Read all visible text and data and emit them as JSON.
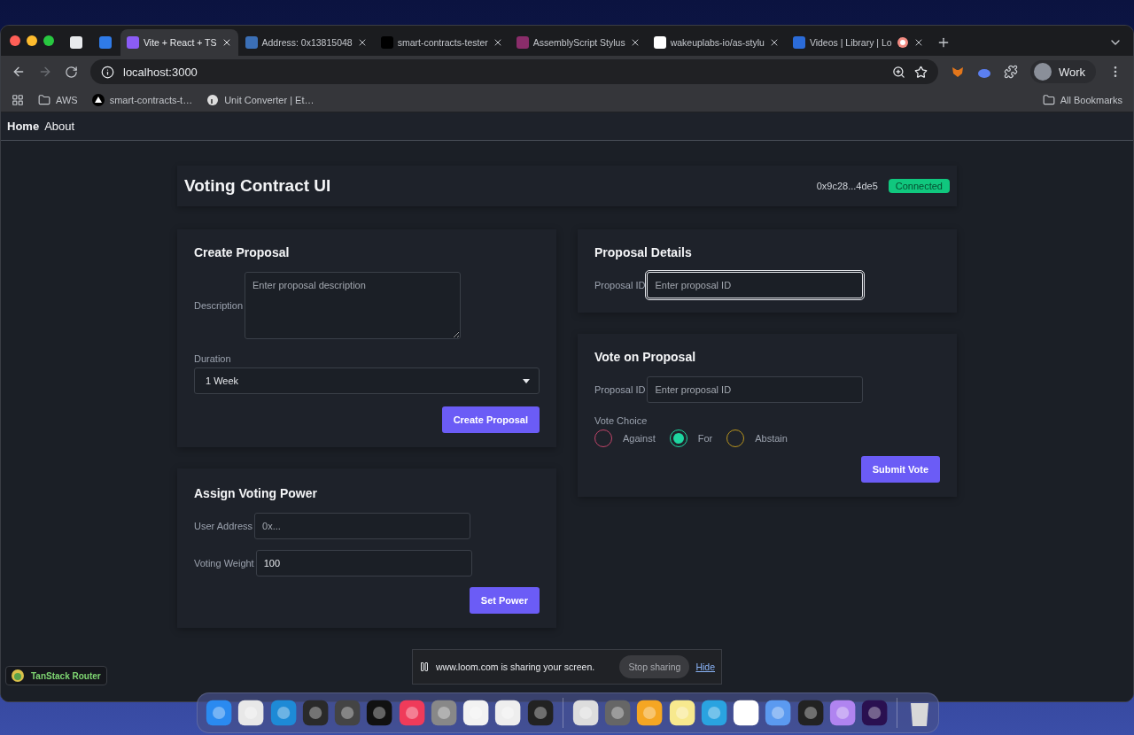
{
  "browser": {
    "tabs": [
      {
        "kind": "pinned",
        "selected": false,
        "recording": false
      },
      {
        "kind": "pinned",
        "selected": false,
        "recording": false
      },
      {
        "kind": "page",
        "title": "Vite + React + TS",
        "selected": true,
        "recording": false
      },
      {
        "kind": "page",
        "title": "Address: 0x13815048",
        "selected": false,
        "recording": false
      },
      {
        "kind": "page",
        "title": "smart-contracts-tester",
        "selected": false,
        "recording": false
      },
      {
        "kind": "page",
        "title": "AssemblyScript Stylus",
        "selected": false,
        "recording": false
      },
      {
        "kind": "page",
        "title": "wakeuplabs-io/as-stylu",
        "selected": false,
        "recording": false
      },
      {
        "kind": "page",
        "title": "Videos | Library | Lo",
        "selected": false,
        "recording": true
      }
    ],
    "address": "localhost:3000",
    "profile": "Work",
    "bookmarks": [
      {
        "kind": "folder",
        "label": "AWS"
      },
      {
        "kind": "site",
        "label": "smart-contracts-t…"
      },
      {
        "kind": "site",
        "label": "Unit Converter | Et…"
      }
    ],
    "all_bookmarks": "All Bookmarks"
  },
  "nav": [
    {
      "label": "Home",
      "selected": true
    },
    {
      "label": "About",
      "selected": false
    }
  ],
  "header": {
    "title": "Voting Contract UI",
    "account": "0x9c28...4de5",
    "status": "Connected"
  },
  "create_proposal": {
    "title": "Create Proposal",
    "description_label": "Description",
    "description_placeholder": "Enter proposal description",
    "duration_label": "Duration",
    "duration_value": "1 Week",
    "button": "Create Proposal"
  },
  "assign_power": {
    "title": "Assign Voting Power",
    "address_label": "User Address",
    "address_placeholder": "0x...",
    "weight_label": "Voting Weight",
    "weight_value": "100",
    "button": "Set Power"
  },
  "proposal_details": {
    "title": "Proposal Details",
    "id_label": "Proposal ID",
    "id_placeholder": "Enter proposal ID",
    "focused": true
  },
  "vote": {
    "title": "Vote on Proposal",
    "id_label": "Proposal ID",
    "id_placeholder": "Enter proposal ID",
    "choice_label": "Vote Choice",
    "options": [
      {
        "label": "Against",
        "color": "#c2456a",
        "selected": false
      },
      {
        "label": "For",
        "color": "#1ed6a0",
        "selected": true
      },
      {
        "label": "Abstain",
        "color": "#b8941e",
        "selected": false
      }
    ],
    "button": "Submit Vote"
  },
  "screen_share": {
    "message": "www.loom.com is sharing your screen.",
    "stop": "Stop sharing",
    "hide": "Hide"
  },
  "devtools": {
    "label": "TanStack Router"
  }
}
